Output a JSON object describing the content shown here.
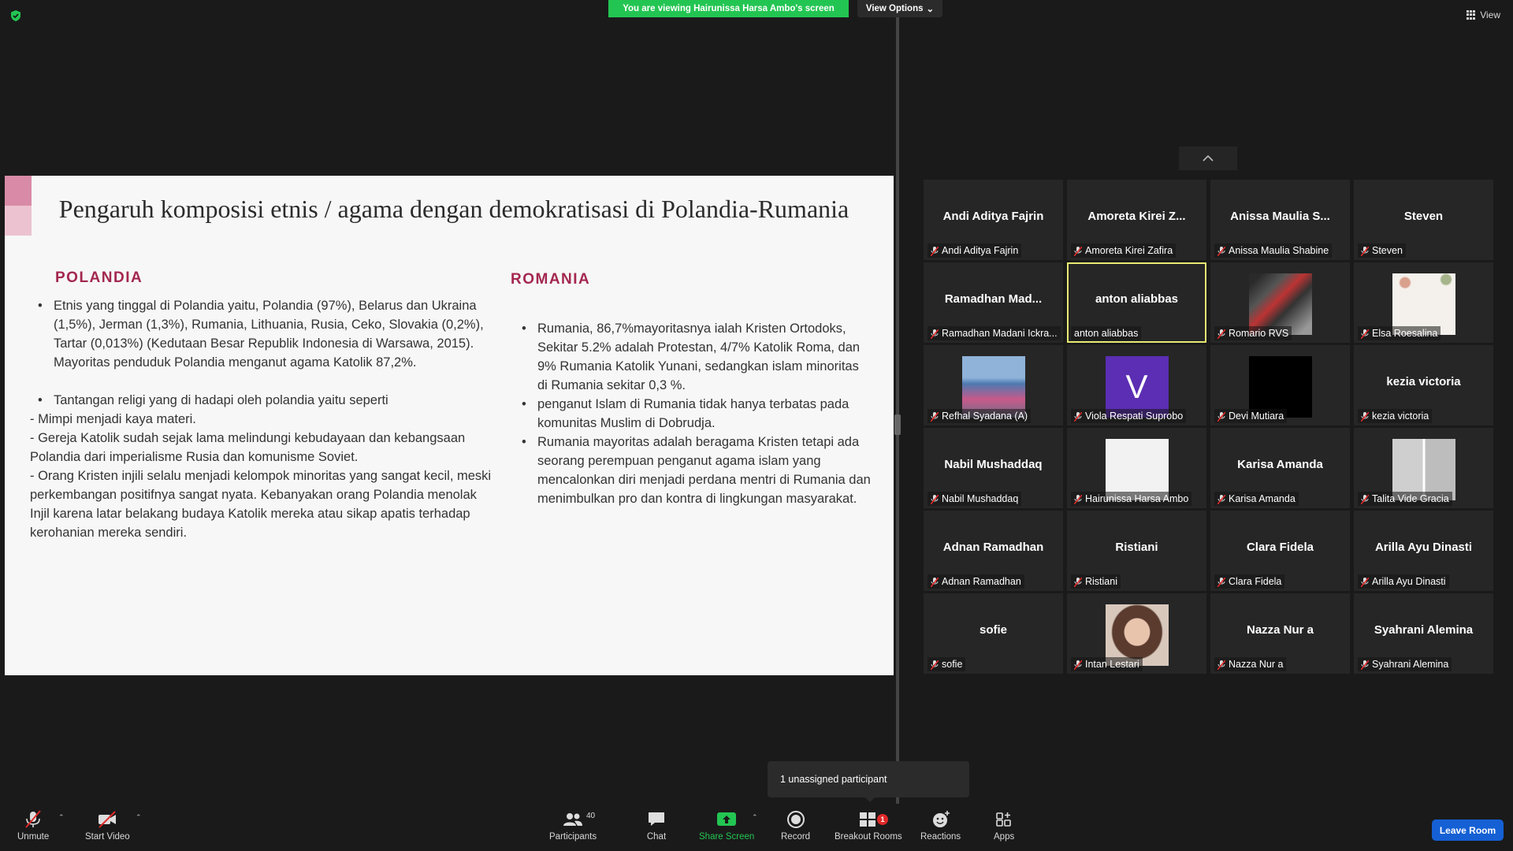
{
  "banner": {
    "viewing": "You are viewing Hairunissa Harsa Ambo's screen",
    "view_options": "View Options"
  },
  "top_right": {
    "view_label": "View"
  },
  "slide": {
    "title": "Pengaruh komposisi etnis / agama  dengan demokratisasi di Polandia-Rumania",
    "left_heading": "POLANDIA",
    "right_heading": "ROMANIA",
    "left_lines": [
      {
        "type": "bullet",
        "text": "Etnis yang tinggal di Polandia yaitu, Polandia (97%), Belarus dan Ukraina (1,5%), Jerman (1,3%), Rumania, Lithuania, Rusia, Ceko, Slovakia (0,2%), Tartar (0,013%) (Kedutaan Besar Republik Indonesia di Warsawa, 2015). Mayoritas penduduk Polandia menganut agama Katolik 87,2%."
      },
      {
        "type": "gap",
        "text": ""
      },
      {
        "type": "bullet",
        "text": "Tantangan  religi yang di hadapi oleh polandia yaitu seperti"
      },
      {
        "type": "plain",
        "text": "- Mimpi menjadi kaya materi."
      },
      {
        "type": "plain",
        "text": "- Gereja Katolik sudah sejak lama melindungi kebudayaan dan kebangsaan Polandia dari imperialisme Rusia dan komunisme Soviet."
      },
      {
        "type": "plain",
        "text": "- Orang Kristen injili selalu menjadi kelompok minoritas yang sangat kecil, meski perkembangan positifnya sangat nyata. Kebanyakan orang Polandia menolak Injil karena latar belakang budaya Katolik mereka atau sikap apatis terhadap kerohanian mereka sendiri."
      }
    ],
    "right_lines": [
      {
        "type": "bullet",
        "text": "Rumania, 86,7%mayoritasnya ialah  Kristen Ortodoks, Sekitar 5.2% adalah Protestan, 4/7% Katolik Roma, dan 9% Rumania Katolik Yunani, sedangkan islam minoritas di Rumania sekitar 0,3 %."
      },
      {
        "type": "bullet",
        "text": " penganut Islam di Rumania tidak hanya terbatas pada komunitas Muslim di Dobrudja."
      },
      {
        "type": "bullet",
        "text": "Rumania mayoritas adalah beragama Kristen tetapi ada seorang perempuan penganut agama islam yang mencalonkan diri menjadi perdana mentri di Rumania dan menimbulkan pro dan kontra di lingkungan masyarakat."
      }
    ]
  },
  "participants": [
    {
      "display": "Andi Aditya Fajrin",
      "label": "Andi Aditya Fajrin",
      "photo": ""
    },
    {
      "display": "Amoreta Kirei Z...",
      "label": "Amoreta Kirei Zafira",
      "photo": ""
    },
    {
      "display": "Anissa Maulia S...",
      "label": "Anissa Maulia Shabine",
      "photo": ""
    },
    {
      "display": "Steven",
      "label": "Steven",
      "photo": ""
    },
    {
      "display": "Ramadhan  Mad...",
      "label": "Ramadhan Madani Ickra...",
      "photo": ""
    },
    {
      "display": "anton aliabbas",
      "label": "anton aliabbas",
      "photo": "",
      "active": true,
      "unmuted": true
    },
    {
      "display": "",
      "label": "Romario RVS",
      "photo": "ph-moto"
    },
    {
      "display": "",
      "label": "Elsa Roesalina",
      "photo": "ph-flowers"
    },
    {
      "display": "",
      "label": "Refhal Syadana (A)",
      "photo": "ph-group"
    },
    {
      "display": "",
      "label": "Viola Respati Suprobo",
      "photo": "ph-v",
      "initial": "V"
    },
    {
      "display": "",
      "label": "Devi Mutiara",
      "photo": "ph-black"
    },
    {
      "display": "kezia victoria",
      "label": "kezia victoria",
      "photo": ""
    },
    {
      "display": "Nabil Mushaddaq",
      "label": "Nabil Mushaddaq",
      "photo": ""
    },
    {
      "display": "",
      "label": "Hairunissa Harsa Ambo",
      "photo": "ph-hijab"
    },
    {
      "display": "Karisa Amanda",
      "label": "Karisa Amanda",
      "photo": ""
    },
    {
      "display": "",
      "label": "Talita Vide Gracia",
      "photo": "ph-collage"
    },
    {
      "display": "Adnan Ramadhan",
      "label": "Adnan Ramadhan",
      "photo": ""
    },
    {
      "display": "Ristiani",
      "label": "Ristiani",
      "photo": ""
    },
    {
      "display": "Clara Fidela",
      "label": "Clara Fidela",
      "photo": ""
    },
    {
      "display": "Arilla Ayu Dinasti",
      "label": "Arilla Ayu Dinasti",
      "photo": ""
    },
    {
      "display": "sofie",
      "label": "sofie",
      "photo": ""
    },
    {
      "display": "",
      "label": "Intan Lestari",
      "photo": "ph-intan"
    },
    {
      "display": "Nazza Nur a",
      "label": "Nazza Nur a",
      "photo": ""
    },
    {
      "display": "Syahrani Alemina",
      "label": "Syahrani Alemina",
      "photo": ""
    }
  ],
  "tooltip": {
    "text": "1 unassigned participant"
  },
  "toolbar": {
    "unmute": "Unmute",
    "start_video": "Start Video",
    "participants": "Participants",
    "participants_count": "40",
    "chat": "Chat",
    "share_screen": "Share Screen",
    "record": "Record",
    "breakout_rooms": "Breakout Rooms",
    "breakout_badge": "1",
    "reactions": "Reactions",
    "apps": "Apps",
    "leave": "Leave Room"
  },
  "colors": {
    "share_green": "#23c552",
    "leave_blue": "#1560d4",
    "active_speaker": "#e8ea74",
    "slide_heading": "#a3274f"
  }
}
